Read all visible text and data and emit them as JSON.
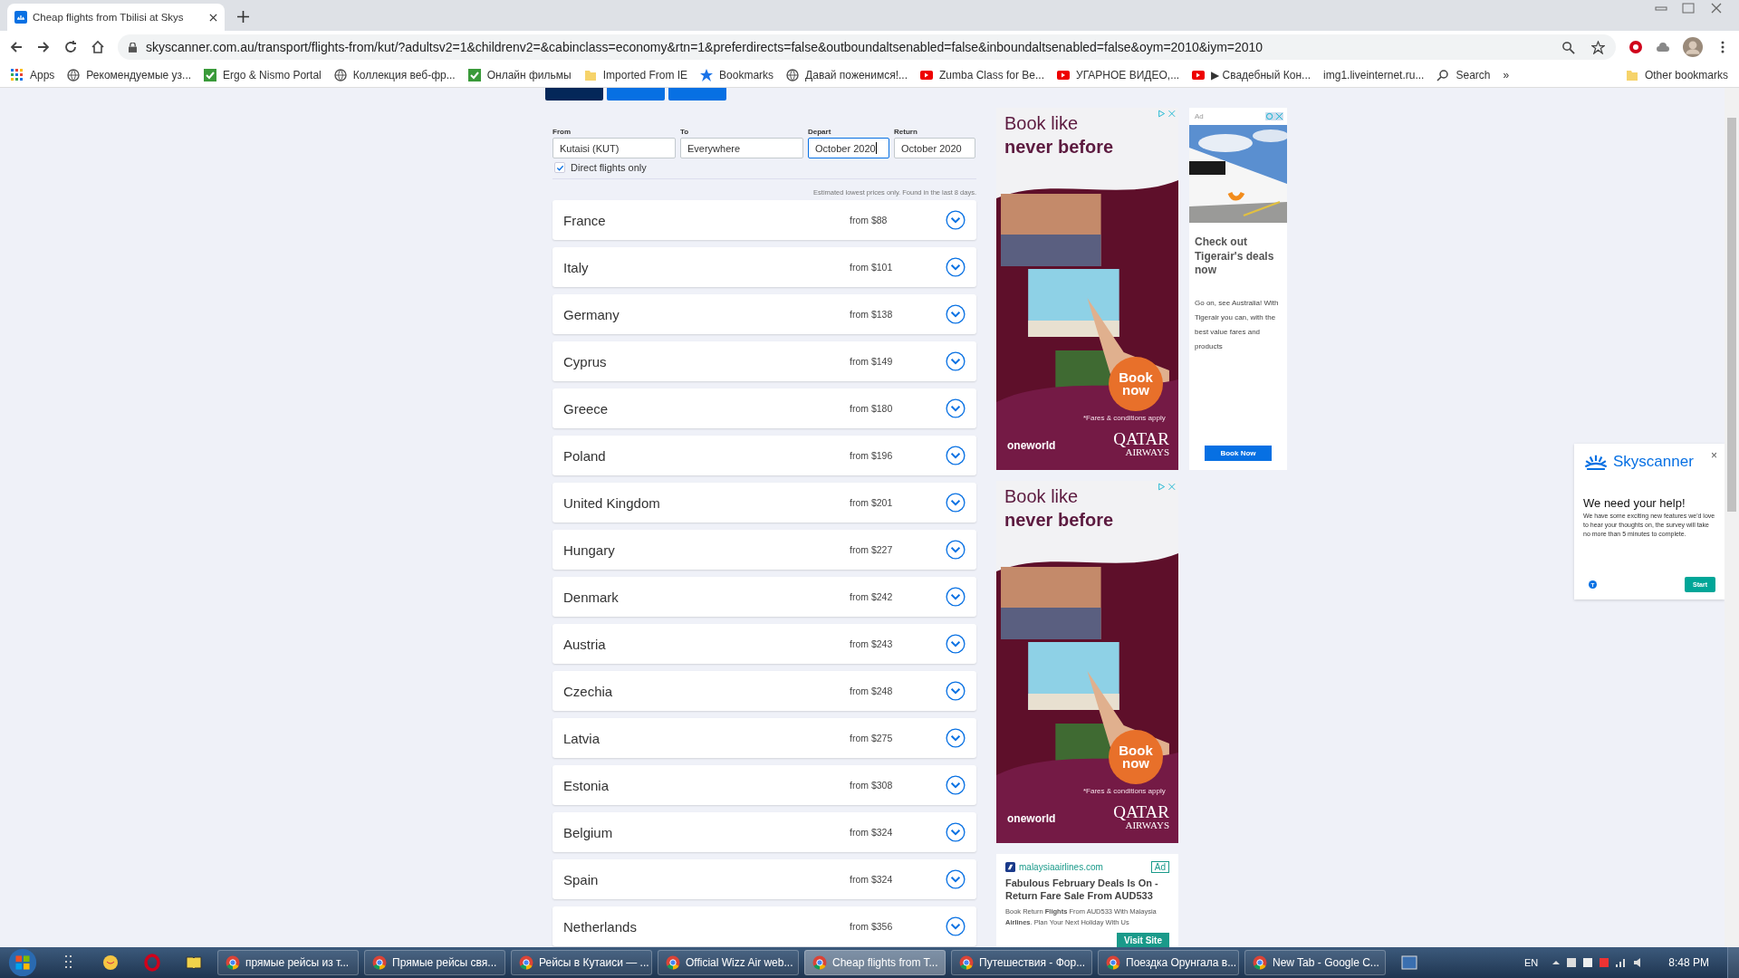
{
  "browser": {
    "tab_title": "Cheap flights from Tbilisi at Skys",
    "url": "skyscanner.com.au/transport/flights-from/kut/?adultsv2=1&childrenv2=&cabinclass=economy&rtn=1&preferdirects=false&outboundaltsenabled=false&inboundaltsenabled=false&oym=2010&iym=2010",
    "bookmarks": [
      {
        "label": "Apps",
        "kind": "apps"
      },
      {
        "label": "Рекомендуемые уз...",
        "kind": "site"
      },
      {
        "label": "Ergo & Nismo Portal",
        "kind": "check"
      },
      {
        "label": "Коллекция веб-фр...",
        "kind": "site"
      },
      {
        "label": "Онлайн фильмы",
        "kind": "check"
      },
      {
        "label": "Imported From IE",
        "kind": "folder"
      },
      {
        "label": "Bookmarks",
        "kind": "star"
      },
      {
        "label": "Давай поженимся!...",
        "kind": "site"
      },
      {
        "label": "Zumba Class for Be...",
        "kind": "video"
      },
      {
        "label": "УГАРНОЕ ВИДЕО,...",
        "kind": "video"
      },
      {
        "label": "▶ Свадебный Кон...",
        "kind": "video"
      },
      {
        "label": "img1.liveinternet.ru...",
        "kind": "plain"
      },
      {
        "label": "Search",
        "kind": "search"
      },
      {
        "label": "»",
        "kind": "plain"
      },
      {
        "label": "Other bookmarks",
        "kind": "folder"
      }
    ]
  },
  "nav_tabs": [
    {
      "selected": true
    },
    {
      "selected": false
    },
    {
      "selected": false
    }
  ],
  "form": {
    "fields": [
      {
        "label": "From",
        "value": "Kutaisi (KUT)",
        "focused": false
      },
      {
        "label": "To",
        "value": "Everywhere",
        "focused": false
      },
      {
        "label": "Depart",
        "value": "October 2020",
        "focused": true
      },
      {
        "label": "Return",
        "value": "October 2020",
        "focused": false
      }
    ],
    "direct_only": {
      "label": "Direct flights only",
      "checked": true
    },
    "note": "Estimated lowest prices only. Found in the last 8 days."
  },
  "destinations": [
    {
      "name": "France",
      "price": "from $88"
    },
    {
      "name": "Italy",
      "price": "from $101"
    },
    {
      "name": "Germany",
      "price": "from $138"
    },
    {
      "name": "Cyprus",
      "price": "from $149"
    },
    {
      "name": "Greece",
      "price": "from $180"
    },
    {
      "name": "Poland",
      "price": "from $196"
    },
    {
      "name": "United Kingdom",
      "price": "from $201"
    },
    {
      "name": "Hungary",
      "price": "from $227"
    },
    {
      "name": "Denmark",
      "price": "from $242"
    },
    {
      "name": "Austria",
      "price": "from $243"
    },
    {
      "name": "Czechia",
      "price": "from $248"
    },
    {
      "name": "Latvia",
      "price": "from $275"
    },
    {
      "name": "Estonia",
      "price": "from $308"
    },
    {
      "name": "Belgium",
      "price": "from $324"
    },
    {
      "name": "Spain",
      "price": "from $324"
    },
    {
      "name": "Netherlands",
      "price": "from $356"
    }
  ],
  "qatar_ads": [
    {
      "headline_1": "Book like",
      "headline_2": "never before",
      "badge": "Book now",
      "fine_print": "*Fares & conditions apply",
      "alliance": "oneworld",
      "brand_1": "QATAR",
      "brand_2": "AIRWAYS"
    },
    {
      "headline_1": "Book like",
      "headline_2": "never before",
      "badge": "Book now",
      "fine_print": "*Fares & conditions apply",
      "alliance": "oneworld",
      "brand_1": "QATAR",
      "brand_2": "AIRWAYS"
    }
  ],
  "malaysia_ad": {
    "domain": "malaysiaairlines.com",
    "tag": "Ad",
    "title": "Fabulous February Deals Is On - Return Fare Sale From AUD533",
    "body": "Book Return **Flights** From AUD533 With Malaysia **Airlines**. Plan Your Next Holiday With Us",
    "button": "Visit Site"
  },
  "tigerair_ad": {
    "tag": "Ad",
    "title": "Check out Tigerair's deals now",
    "body": "Go on, see Australia! With Tigerair you can, with the best value fares and products",
    "button": "Book Now"
  },
  "survey": {
    "brand": "Skyscanner",
    "close": "×",
    "title": "We need your help!",
    "text": "We have some exciting new features we'd love to hear your thoughts on, the survey will take no more than 5 minutes to complete.",
    "button": "Start"
  },
  "taskbar": {
    "tasks": [
      {
        "label": "прямые рейсы из т...",
        "selected": false
      },
      {
        "label": "Прямые рейсы свя...",
        "selected": false
      },
      {
        "label": "Рейсы в Кутаиси — ...",
        "selected": false
      },
      {
        "label": "Official Wizz Air web...",
        "selected": false
      },
      {
        "label": "Cheap flights from T...",
        "selected": true
      },
      {
        "label": "Путешествия - Фор...",
        "selected": false
      },
      {
        "label": "Поездка Орунгала в...",
        "selected": false
      },
      {
        "label": "New Tab - Google C...",
        "selected": false
      }
    ],
    "language": "EN",
    "time": "8:48 PM"
  }
}
